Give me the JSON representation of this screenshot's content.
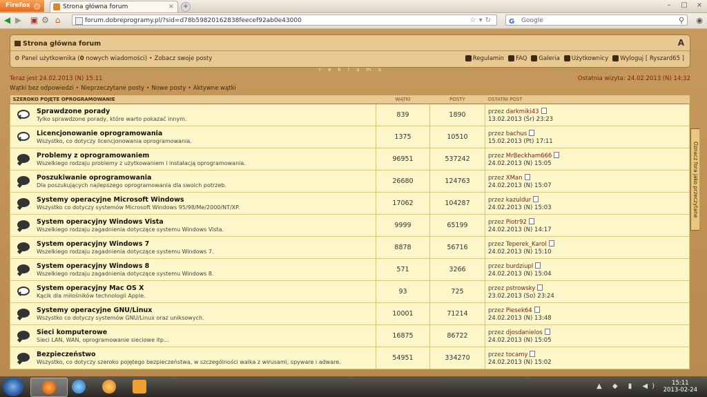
{
  "browser": {
    "menu_button": "Firefox",
    "tab_title": "Strona główna forum",
    "url": "forum.dobreprogramy.pl/?sid=d78b59820162838feecef92ab0e43000",
    "search_placeholder": "Google"
  },
  "header": {
    "forum_title": "Strona główna forum",
    "user_panel_label": "Panel użytkownika",
    "new_messages_count": "0",
    "new_messages_text": "nowych wiadomości",
    "own_posts_link": "Zobacz swoje posty",
    "links": [
      "Regulamin",
      "FAQ",
      "Galeria",
      "Użytkownicy",
      "Wyloguj [ Ryszard65 ]"
    ]
  },
  "ad_label": "r e k l a m a",
  "status": {
    "now": "Teraz jest 24.02.2013 (N) 15:11",
    "last_visit": "Ostatnia wizyta: 24.02.2013 (N) 14:32"
  },
  "quick_links": [
    "Wątki bez odpowiedzi",
    "Nieprzeczytane posty",
    "Nowe posty",
    "Aktywne wątki"
  ],
  "side_tab": "Oznacz fora jako przeczytane",
  "table": {
    "section_title": "SZEROKO POJĘTE OPROGRAMOWANIE",
    "col_topics": "WĄTKI",
    "col_posts": "POSTY",
    "col_last": "OSTATNI POST",
    "by_prefix": "przez",
    "rows": [
      {
        "name": "Sprawdzone porady",
        "desc": "Tylko sprawdzone porady, które warto pokazać innym.",
        "topics": "839",
        "posts": "1890",
        "author": "darkmiki43",
        "date": "13.02.2013 (Śr) 23:23",
        "read": true
      },
      {
        "name": "Licencjonowanie oprogramowania",
        "desc": "Wszystko, co dotyczy licencjonowania oprogramowania.",
        "topics": "1375",
        "posts": "10510",
        "author": "bachus",
        "date": "15.02.2013 (Pt) 17:11",
        "read": true
      },
      {
        "name": "Problemy z oprogramowaniem",
        "desc": "Wszelkiego rodzaju problemy z użytkowaniem i instalacją oprogramowania.",
        "topics": "96951",
        "posts": "537242",
        "author": "MrBeckham666",
        "date": "24.02.2013 (N) 15:05",
        "read": false
      },
      {
        "name": "Poszukiwanie oprogramowania",
        "desc": "Dla poszukujących najlepszego oprogramowania dla swoich potrzeb.",
        "topics": "26680",
        "posts": "124763",
        "author": "XMan",
        "date": "24.02.2013 (N) 15:07",
        "read": false
      },
      {
        "name": "Systemy operacyjne Microsoft Windows",
        "desc": "Wszystko co dotyczy systemów Microsoft Windows 95/98/Me/2000/NT/XP.",
        "topics": "17062",
        "posts": "104287",
        "author": "kazuldur",
        "date": "24.02.2013 (N) 15:03",
        "read": false
      },
      {
        "name": "System operacyjny Windows Vista",
        "desc": "Wszelkiego rodzaju zagadnienia dotyczące systemu Windows Vista.",
        "topics": "9999",
        "posts": "65199",
        "author": "Piotr92",
        "date": "24.02.2013 (N) 14:17",
        "read": false
      },
      {
        "name": "System operacyjny Windows 7",
        "desc": "Wszelkiego rodzaju zagadnienia dotyczące systemu Windows 7.",
        "topics": "8878",
        "posts": "56716",
        "author": "Teperek_Karol",
        "date": "24.02.2013 (N) 15:10",
        "read": false
      },
      {
        "name": "System operacyjny Windows 8",
        "desc": "Wszelkiego rodzaju zagadnienia dotyczące systemu Windows 8.",
        "topics": "571",
        "posts": "3266",
        "author": "burdziupl",
        "date": "24.02.2013 (N) 15:04",
        "read": false
      },
      {
        "name": "System operacyjny Mac OS X",
        "desc": "Kącik dla miłośników technologii Apple.",
        "topics": "93",
        "posts": "725",
        "author": "pstrowsky",
        "date": "23.02.2013 (So) 23:24",
        "read": true
      },
      {
        "name": "Systemy operacyjne GNU/Linux",
        "desc": "Wszystko co dotyczy systemów GNU/Linux oraz uniksowych.",
        "topics": "10001",
        "posts": "71214",
        "author": "Piesek64",
        "date": "24.02.2013 (N) 13:48",
        "read": false
      },
      {
        "name": "Sieci komputerowe",
        "desc": "Sieci LAN, WAN, oprogramowanie sieciowe itp...",
        "topics": "16875",
        "posts": "86722",
        "author": "djosdanielos",
        "date": "24.02.2013 (N) 15:05",
        "read": false
      },
      {
        "name": "Bezpieczeństwo",
        "desc": "Wszystko, co dotyczy szeroko pojętego bezpieczeństwa, w szczególności walka z wirusami, spyware i adware.",
        "topics": "54951",
        "posts": "334270",
        "author": "tocamy",
        "date": "24.02.2013 (N) 15:02",
        "read": false
      }
    ]
  },
  "taskbar": {
    "time": "15:11",
    "date": "2013-02-24"
  }
}
